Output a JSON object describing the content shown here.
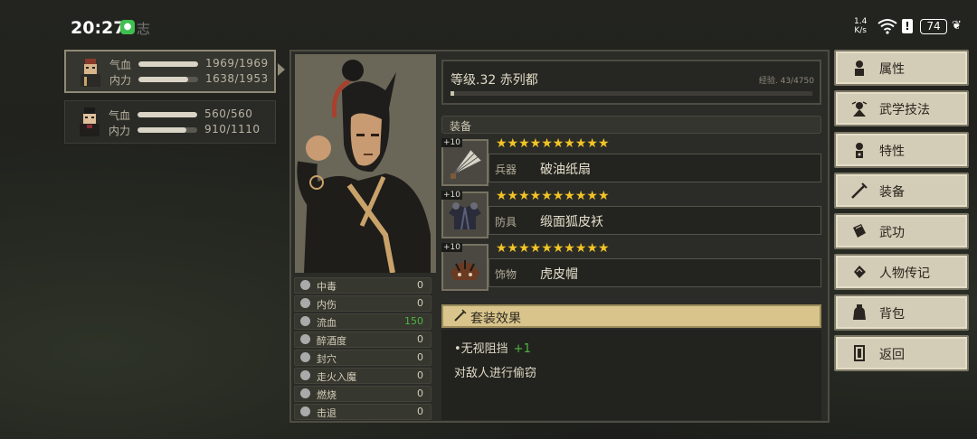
{
  "status_bar": {
    "time": "20:27",
    "partial_label": "志",
    "net_speed_value": "1.4",
    "net_speed_unit": "K/s",
    "battery": "74"
  },
  "party": [
    {
      "hp_label": "气血",
      "hp": "1969/1969",
      "hp_fraction": 1.0,
      "mp_label": "内力",
      "mp": "1638/1953",
      "mp_fraction": 0.84
    },
    {
      "hp_label": "气血",
      "hp": "560/560",
      "hp_fraction": 1.0,
      "mp_label": "内力",
      "mp": "910/1110",
      "mp_fraction": 0.82
    }
  ],
  "character": {
    "level_text": "等级.32  赤列都",
    "exp_text": "经验. 43/4750",
    "exp_fraction": 0.01
  },
  "equipment": {
    "header": "装备",
    "items": [
      {
        "plus": "+10",
        "stars": "★★★★★★★★★★",
        "type": "兵器",
        "name": "破油纸扇"
      },
      {
        "plus": "+10",
        "stars": "★★★★★★★★★★",
        "type": "防具",
        "name": "缎面狐皮袄"
      },
      {
        "plus": "+10",
        "stars": "★★★★★★★★★★",
        "type": "饰物",
        "name": "虎皮帽"
      }
    ]
  },
  "set_effect": {
    "header": "套装效果",
    "effect_name": "•无视阻挡",
    "effect_bonus": "+1",
    "description": "对敌人进行偷窃"
  },
  "statuses": [
    {
      "label": "中毒",
      "value": "0",
      "icon": "skull-icon"
    },
    {
      "label": "内伤",
      "value": "0",
      "icon": "broken-heart-icon"
    },
    {
      "label": "流血",
      "value": "150",
      "icon": "blood-icon",
      "highlight": true
    },
    {
      "label": "醉酒度",
      "value": "0",
      "icon": "drunk-icon"
    },
    {
      "label": "封穴",
      "value": "0",
      "icon": "pin-icon"
    },
    {
      "label": "走火入魔",
      "value": "0",
      "icon": "yin-yang-icon"
    },
    {
      "label": "燃烧",
      "value": "0",
      "icon": "fire-icon"
    },
    {
      "label": "击退",
      "value": "0",
      "icon": "knockback-icon"
    }
  ],
  "menu": [
    {
      "label": "属性",
      "icon": "attributes-icon"
    },
    {
      "label": "武学技法",
      "icon": "martial-skill-icon"
    },
    {
      "label": "特性",
      "icon": "trait-icon"
    },
    {
      "label": "装备",
      "icon": "sword-icon"
    },
    {
      "label": "武功",
      "icon": "book-icon"
    },
    {
      "label": "人物传记",
      "icon": "scroll-icon"
    },
    {
      "label": "背包",
      "icon": "bag-icon"
    },
    {
      "label": "返回",
      "icon": "door-icon"
    }
  ],
  "colors": {
    "star": "#f2c425",
    "bonus_green": "#4fb442",
    "set_header_bg": "#d9c58c",
    "menu_bg": "#d3ccb6"
  }
}
